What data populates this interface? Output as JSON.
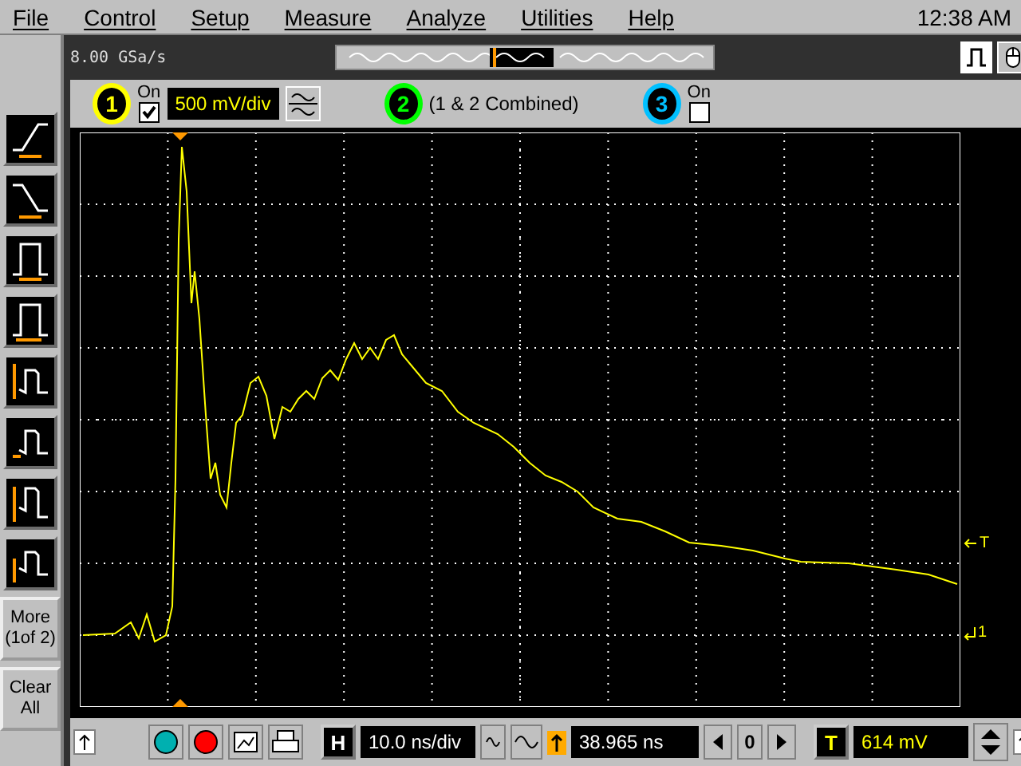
{
  "menu": [
    "File",
    "Control",
    "Setup",
    "Measure",
    "Analyze",
    "Utilities",
    "Help"
  ],
  "clock": "12:38 AM",
  "sample_rate": "8.00 GSa/s",
  "channels": [
    {
      "number": "1",
      "color": "#ffff00",
      "on_label": "On",
      "checked": true,
      "scale": "500 mV/div"
    },
    {
      "number": "2",
      "color": "#00ff00",
      "label": "(1 & 2 Combined)"
    },
    {
      "number": "3",
      "color": "#00c0ff",
      "on_label": "On",
      "checked": false
    }
  ],
  "measure_buttons": [
    {
      "label": "More (1of 2)"
    },
    {
      "label": "Clear All"
    }
  ],
  "trigger_marker": "T",
  "ground_marker": "1",
  "horizontal": {
    "key": "H",
    "scale": "10.0 ns/div",
    "position": "38.965 ns",
    "step": "0"
  },
  "trigger": {
    "key": "T",
    "level": "614 mV"
  }
}
